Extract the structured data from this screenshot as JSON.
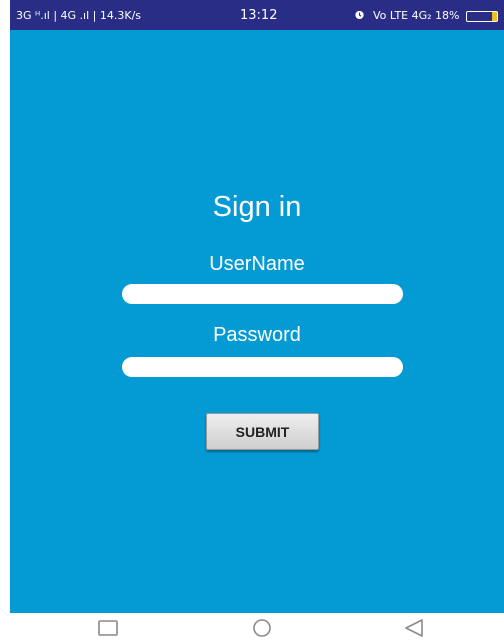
{
  "status_bar": {
    "left_text": "3G ᴴ.ıl | 4G .ıl | 14.3K/s",
    "time": "13:12",
    "right_text": "Vo LTE 4G₂ 18%",
    "alarm_icon": "alarm-clock-icon",
    "battery_level": 0.18,
    "battery_color": "#f0c020"
  },
  "colors": {
    "status_bar_bg": "#2a2d86",
    "app_bg": "#049ad4",
    "text": "#ffffff",
    "button_bg": "#e0e0e0"
  },
  "login": {
    "title": "Sign in",
    "username_label": "UserName",
    "username_value": "",
    "password_label": "Password",
    "password_value": "",
    "submit_label": "SUBMIT"
  },
  "nav_bar": {
    "recent_icon": "square-recent-apps-icon",
    "home_icon": "circle-home-icon",
    "back_icon": "triangle-back-icon"
  }
}
